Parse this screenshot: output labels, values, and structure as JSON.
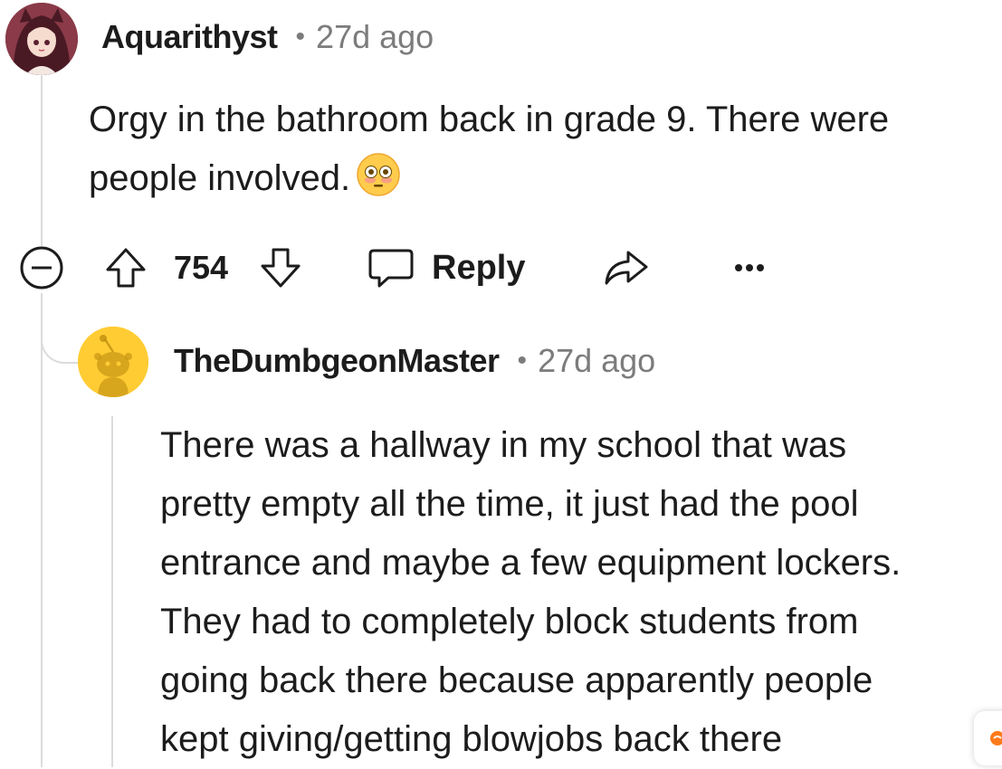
{
  "comment": {
    "username": "Aquarithyst",
    "separator": "•",
    "time": "27d ago",
    "body_lines": [
      "Orgy in the bathroom back in grade 9. There were",
      "people involved."
    ],
    "emoji": "flushed-face",
    "score": "754",
    "reply_label": "Reply"
  },
  "reply": {
    "username": "TheDumbgeonMaster",
    "separator": "•",
    "time": "27d ago",
    "body_lines": [
      "There was a hallway in my school that was",
      "pretty empty all the time, it just had the pool",
      "entrance and maybe a few equipment lockers.",
      "They had to completely block students from",
      "going back there because apparently people",
      "kept giving/getting blowjobs back there"
    ]
  },
  "icons": {
    "collapse": "minus-circle-icon",
    "upvote": "arrow-up-outline-icon",
    "downvote": "arrow-down-outline-icon",
    "reply": "chat-bubble-icon",
    "share": "share-arrow-icon",
    "more": "more-dots-icon"
  },
  "colors": {
    "text": "#1c1c1c",
    "muted": "#7c7c7c",
    "thread_line": "#dcdcdc",
    "snoo_avatar_bg": "#ffcc33"
  }
}
